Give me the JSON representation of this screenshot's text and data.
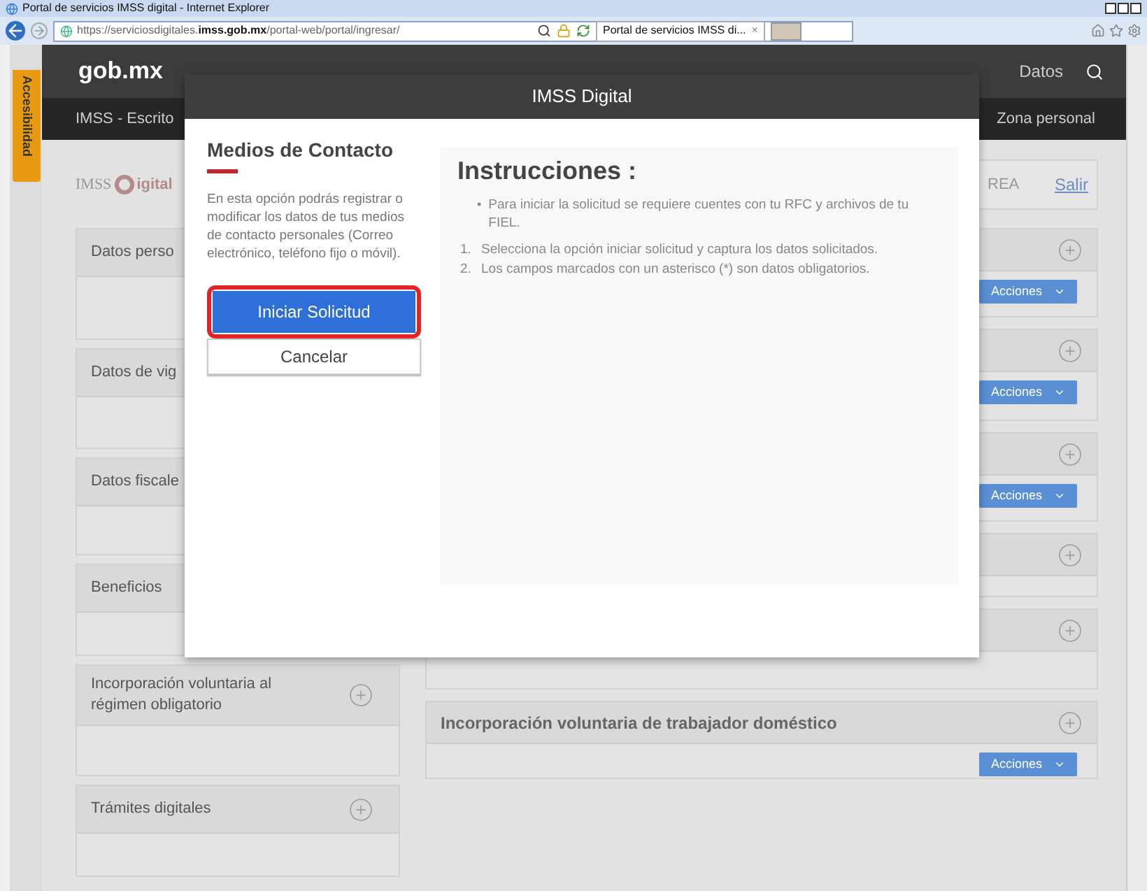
{
  "browser": {
    "title": "Portal de servicios IMSS digital - Internet Explorer",
    "url_prefix": "https://serviciosdigitales.",
    "url_domain": "imss.gob.mx",
    "url_path": "/portal-web/portal/ingresar/",
    "tab_title": "Portal de servicios IMSS di...",
    "tab_close": "×"
  },
  "page": {
    "accessibility": "Accesibilidad",
    "brand": "gob.mx",
    "nav_item": "Datos",
    "subheader": "IMSS - Escrito",
    "zone": "Zona personal",
    "logo_word": "IMSS",
    "logo_suffix": "igital",
    "user_fragment": "REA",
    "logout": "Salir",
    "left_cards": [
      {
        "title": "Datos perso"
      },
      {
        "title": "Datos de vig"
      },
      {
        "title": "Datos fiscale"
      },
      {
        "title": "Beneficios"
      },
      {
        "title": "Incorporación voluntaria al régimen obligatorio"
      },
      {
        "title": "Trámites digitales"
      }
    ],
    "right_cards": [
      {
        "kind": "actions",
        "actions": "Acciones"
      },
      {
        "kind": "actions",
        "actions": "Acciones"
      },
      {
        "kind": "actions",
        "actions": "Acciones"
      },
      {
        "kind": "plain"
      },
      {
        "kind": "plain"
      },
      {
        "kind": "actions",
        "title": "Incorporación voluntaria de trabajador doméstico",
        "actions": "Acciones"
      }
    ]
  },
  "modal": {
    "title": "IMSS Digital",
    "heading": "Medios de Contacto",
    "description": "En esta opción podrás registrar o modificar los datos de tus medios de contacto personales (Correo electrónico, teléfono fijo o móvil).",
    "primary_button": "Iniciar Solicitud",
    "cancel_button": "Cancelar",
    "instructions_title": "Instrucciones :",
    "bullet_mark": "•",
    "bullets": [
      "Para iniciar la solicitud se requiere cuentes con tu RFC y archivos de tu FIEL."
    ],
    "steps": [
      {
        "number": "1.",
        "text": "Selecciona la opción iniciar solicitud y captura los datos solicitados."
      },
      {
        "number": "2.",
        "text": "Los campos marcados con un asterisco (*) son datos obligatorios."
      }
    ]
  }
}
